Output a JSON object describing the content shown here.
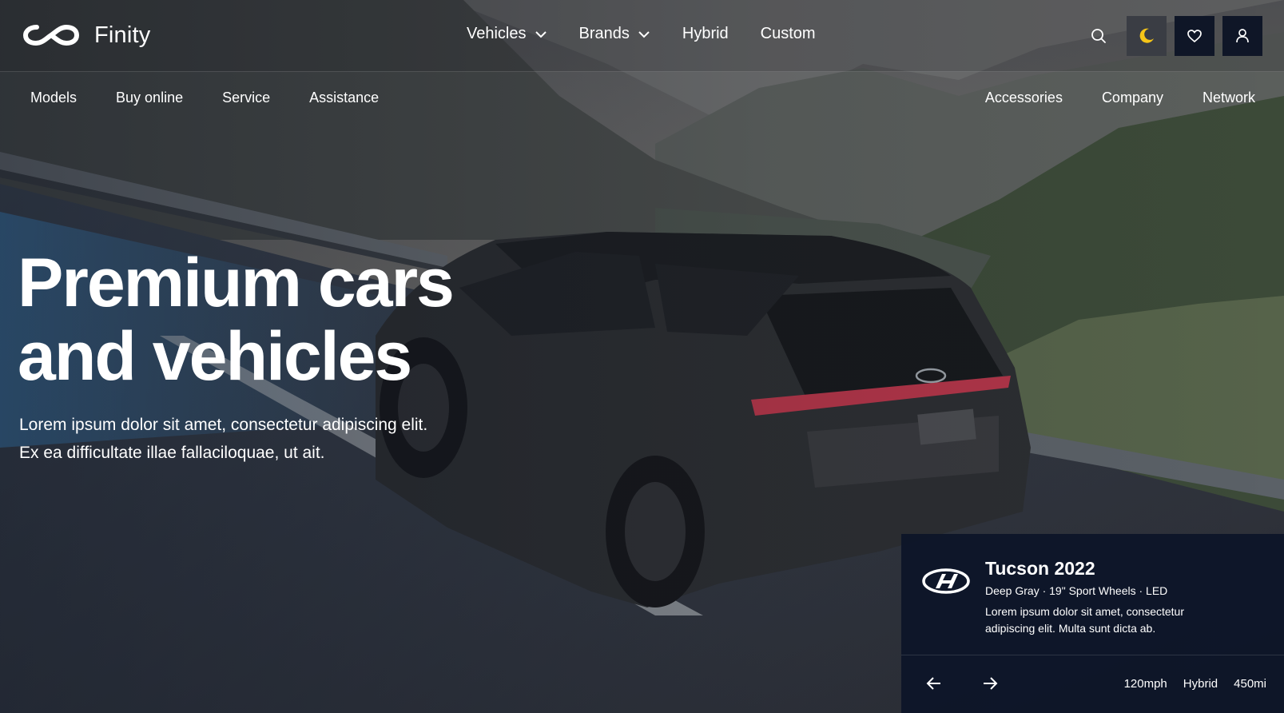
{
  "brand": {
    "name": "Finity"
  },
  "main_nav": [
    {
      "label": "Vehicles",
      "has_dropdown": true
    },
    {
      "label": "Brands",
      "has_dropdown": true
    },
    {
      "label": "Hybrid",
      "has_dropdown": false
    },
    {
      "label": "Custom",
      "has_dropdown": false
    }
  ],
  "toolbar": {
    "search_icon": "search-icon",
    "theme_icon": "moon-icon",
    "wishlist_icon": "heart-icon",
    "account_icon": "user-icon"
  },
  "sub_nav": {
    "left": [
      "Models",
      "Buy online",
      "Service",
      "Assistance"
    ],
    "right": [
      "Accessories",
      "Company",
      "Network"
    ]
  },
  "hero": {
    "title_line1": "Premium cars",
    "title_line2": "and vehicles",
    "subtitle_line1": "Lorem ipsum dolor sit amet, consectetur adipiscing elit.",
    "subtitle_line2": "Ex ea difficultate illae fallaciloquae, ut ait."
  },
  "card": {
    "title": "Tucson 2022",
    "spec": "Deep Gray · 19\" Sport Wheels · LED",
    "description": "Lorem ipsum dolor sit amet, consectetur adipiscing elit. Multa sunt dicta ab.",
    "prev_icon": "arrow-left-icon",
    "next_icon": "arrow-right-icon",
    "stats": [
      "120mph",
      "Hybrid",
      "450mi"
    ]
  },
  "colors": {
    "card_bg": "#0c1428",
    "dark_button": "#0f1627",
    "moon": "#f5c518",
    "water": "#3e7fb6"
  }
}
